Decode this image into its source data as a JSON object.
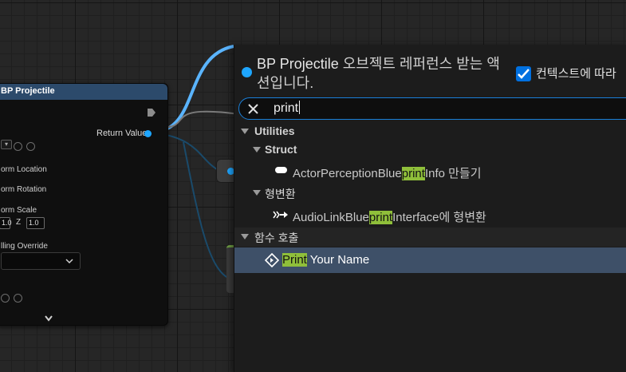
{
  "graph_node": {
    "title": "BP Projectile",
    "return_label": "Return Value",
    "pins": {
      "transform_location": "orm Location",
      "transform_rotation": "orm Rotation",
      "transform_scale": "orm Scale",
      "scale_y_value": "1.0",
      "scale_z_axis": "Z",
      "scale_z_value": "1.0",
      "collision_override": "lling Override"
    }
  },
  "menu": {
    "title_strong": "BP Projectile",
    "title_rest": " 오브젝트 레퍼런스 받는 액션입니다.",
    "context_label": "컨텍스트에 따라",
    "context_checked": true,
    "search_value": "print",
    "categories": [
      {
        "label": "Utilities"
      },
      {
        "label": "Struct"
      },
      {
        "label": "형변환"
      },
      {
        "label": "함수 호출"
      }
    ],
    "items": [
      {
        "pre": "ActorPerceptionBlue",
        "match": "print",
        "post": "Info 만들기"
      },
      {
        "pre": "AudioLinkBlue",
        "match": "print",
        "post": "Interface에 형변환"
      },
      {
        "pre": "",
        "match": "Print",
        "post": " Your Name"
      }
    ]
  },
  "colors": {
    "accent": "#1ea6ff",
    "node_header": "#2c4a6b",
    "highlight": "#8fbf3a",
    "selected_row": "#3e5068"
  }
}
